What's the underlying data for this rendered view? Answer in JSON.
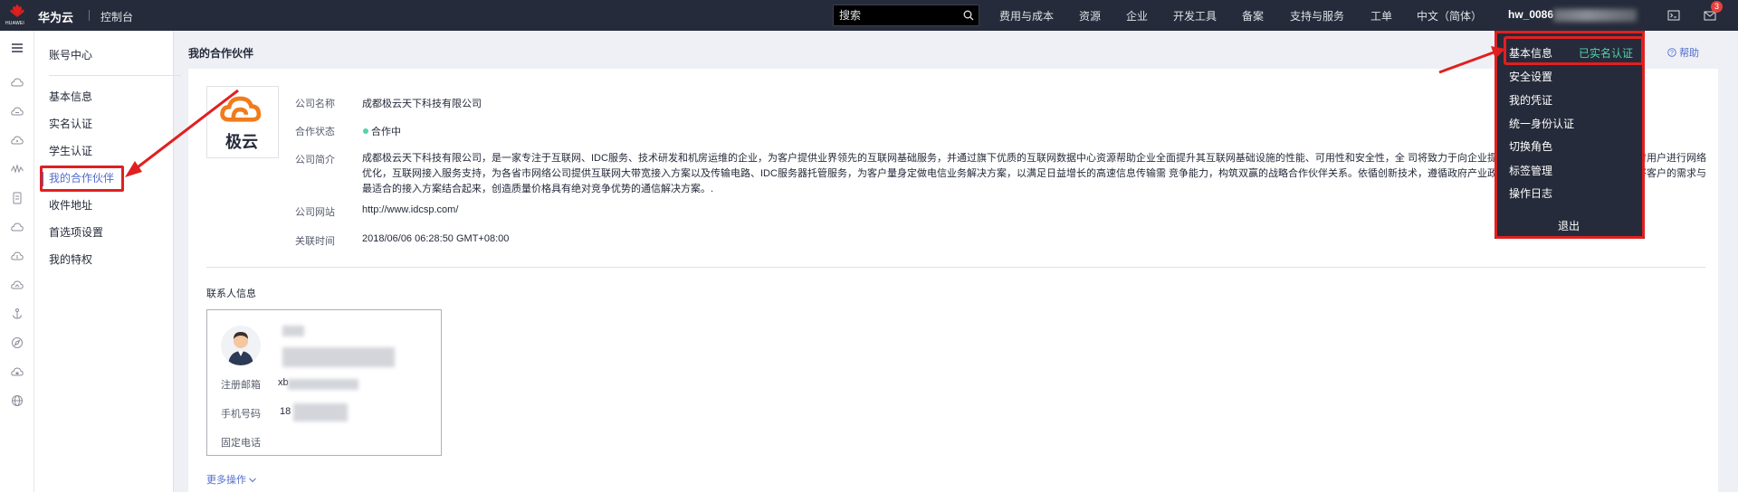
{
  "topbar": {
    "logo_text": "HUAWEI",
    "brand": "华为云",
    "console": "控制台",
    "search_placeholder": "搜索",
    "nav": [
      "费用与成本",
      "资源",
      "企业",
      "开发工具",
      "备案",
      "支持与服务",
      "工单",
      "中文（简体）"
    ],
    "username": "hw_0086",
    "message_count": "3"
  },
  "sidebar": {
    "title": "账号中心",
    "items": [
      {
        "label": "基本信息"
      },
      {
        "label": "实名认证"
      },
      {
        "label": "学生认证"
      },
      {
        "label": "我的合作伙伴"
      },
      {
        "label": "收件地址"
      },
      {
        "label": "首选项设置"
      },
      {
        "label": "我的特权"
      }
    ]
  },
  "main": {
    "title": "我的合作伙伴",
    "help": "帮助",
    "logo_text": "极云",
    "fields": {
      "name_label": "公司名称",
      "name_value": "成都极云天下科技有限公司",
      "status_label": "合作状态",
      "status_value": "合作中",
      "intro_label": "公司简介",
      "intro_value": "成都极云天下科技有限公司，是一家专注于互联网、IDC服务、技术研发和机房运维的企业，为客户提供业界领先的互联网基础服务，并通过旗下优质的互联网数据中心资源帮助企业全面提升其互联网基础设施的性能、可用性和安全性，全                                                                  司将致力于向企业提供电信业务解决方案的服务，针对用户进行网络优化，互联网接入服务支持，为各省市网络公司提供互联网大带宽接入方案以及传输电路、IDC服务器托管服务，为客户量身定做电信业务解决方案，以满足日益增长的高速信息传输需                                                                  竞争能力，构筑双赢的战略合作伙伴关系。依循创新技术，遵循政府产业政策引导，发展紧密的客户关系，将客户的需求与最适合的接入方案结合起来，创造质量价格具有绝对竞争优势的通信解决方案。.",
      "site_label": "公司网站",
      "site_value": "http://www.idcsp.com/",
      "time_label": "关联时间",
      "time_value": "2018/06/06 06:28:50 GMT+08:00"
    },
    "contact": {
      "section_title": "联系人信息",
      "email_label": "注册邮箱",
      "email_value": "xb",
      "phone_label": "手机号码",
      "phone_value": "18",
      "tel_label": "固定电话"
    },
    "more": "更多操作"
  },
  "dropdown": {
    "items": [
      "基本信息",
      "安全设置",
      "我的凭证",
      "统一身份认证",
      "切换角色",
      "标签管理",
      "操作日志"
    ],
    "verified": "已实名认证",
    "logout": "退出"
  },
  "colors": {
    "topbar": "#252b3a",
    "accent": "#526ecc",
    "highlight": "#e02020",
    "status_green": "#50d4ab",
    "logo_orange": "#f07c1d"
  }
}
